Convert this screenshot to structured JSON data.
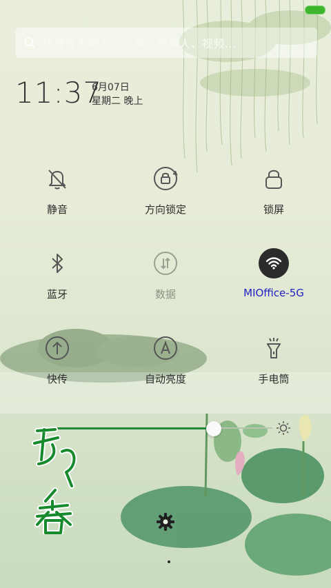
{
  "status_bar": {
    "battery_color": "#3fb52e"
  },
  "search": {
    "placeholder": "快捷搜索网页、应用、联系人、视频..."
  },
  "clock": {
    "time": "11:37",
    "date": "6月07日",
    "weekday_period": "星期二 晚上"
  },
  "toggles": [
    {
      "label": "静音",
      "icon": "bell-off-icon"
    },
    {
      "label": "方向锁定",
      "icon": "rotation-lock-icon"
    },
    {
      "label": "锁屏",
      "icon": "lock-icon"
    },
    {
      "label": "蓝牙",
      "icon": "bluetooth-icon"
    },
    {
      "label": "数据",
      "icon": "mobile-data-icon"
    },
    {
      "label": "MIOffice-5G",
      "icon": "wifi-icon"
    },
    {
      "label": "快传",
      "icon": "upload-icon"
    },
    {
      "label": "自动亮度",
      "icon": "auto-brightness-icon"
    },
    {
      "label": "手电筒",
      "icon": "flashlight-icon"
    }
  ],
  "brightness": {
    "level": 0.73,
    "icon": "sun-icon"
  },
  "calligraphy": "荷香",
  "settings": {
    "icon": "gear-icon"
  },
  "colors": {
    "accent": "#1d8a3a",
    "wifi_label": "#2121c4",
    "wifi_bg": "#2b2b2b"
  }
}
